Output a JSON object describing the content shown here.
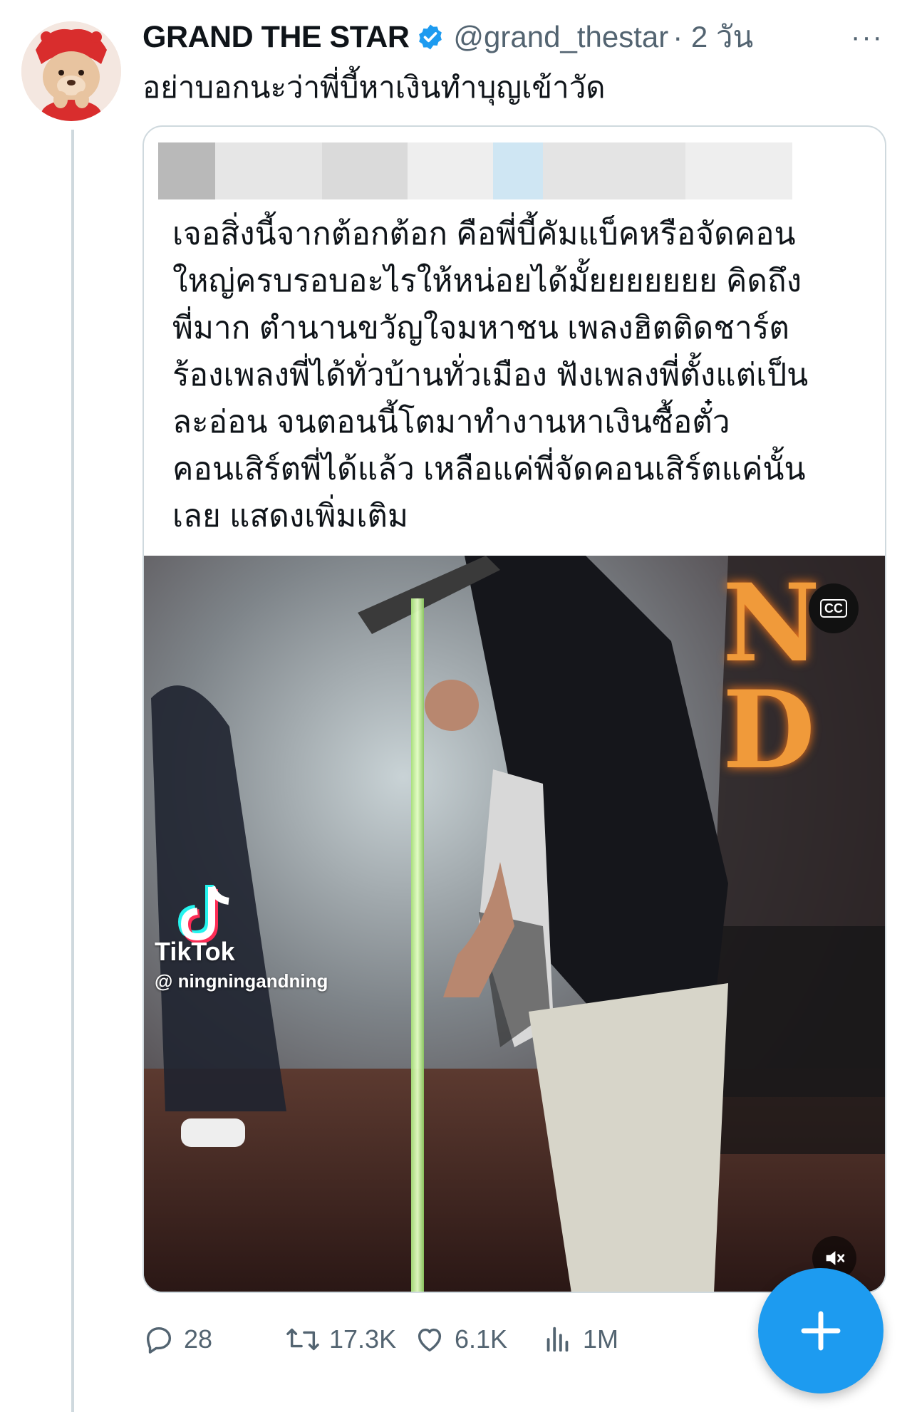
{
  "tweet": {
    "display_name": "GRAND THE STAR",
    "handle": "@grand_thestar",
    "time": "· 2 วัน",
    "more": "···",
    "text": "อย่าบอกนะว่าพี่บี้หาเงินทำบุญเข้าวัด",
    "verified_icon": "verified-badge-icon",
    "verified_color": "#1d9bf0"
  },
  "quote": {
    "text": "เจอสิ่งนี้จากต้อกต้อก คือพี่บี้คัมแบ็คหรือจัดคอน\nใหญ่ครบรอบอะไรให้หน่อยได้มั้ยยยยยยย คิดถึง\nพี่มาก ตำนานขวัญใจมหาชน เพลงฮิตติดชาร์ต\nร้องเพลงพี่ได้ทั่วบ้านทั่วเมือง ฟังเพลงพี่ตั้งแต่เป็น\nละอ่อน จนตอนนี้โตมาทำงานหาเงินซื้อตั๋ว\nคอนเสิร์ตพี่ได้แล้ว เหลือแค่พี่จัดคอนเสิร์ตแค่นั้น\nเลย ",
    "show_more": "แสดงเพิ่มเติม"
  },
  "video": {
    "cc_label": "CC",
    "watermark_brand": "TikTok",
    "watermark_user": "@ ningningandning",
    "sign_letters": [
      "N",
      "D"
    ]
  },
  "actions": {
    "replies": "28",
    "retweets": "17.3K",
    "likes": "6.1K",
    "views": "1M"
  },
  "colors": {
    "accent": "#1d9bf0",
    "muted": "#536471",
    "border": "#cfd9de"
  }
}
